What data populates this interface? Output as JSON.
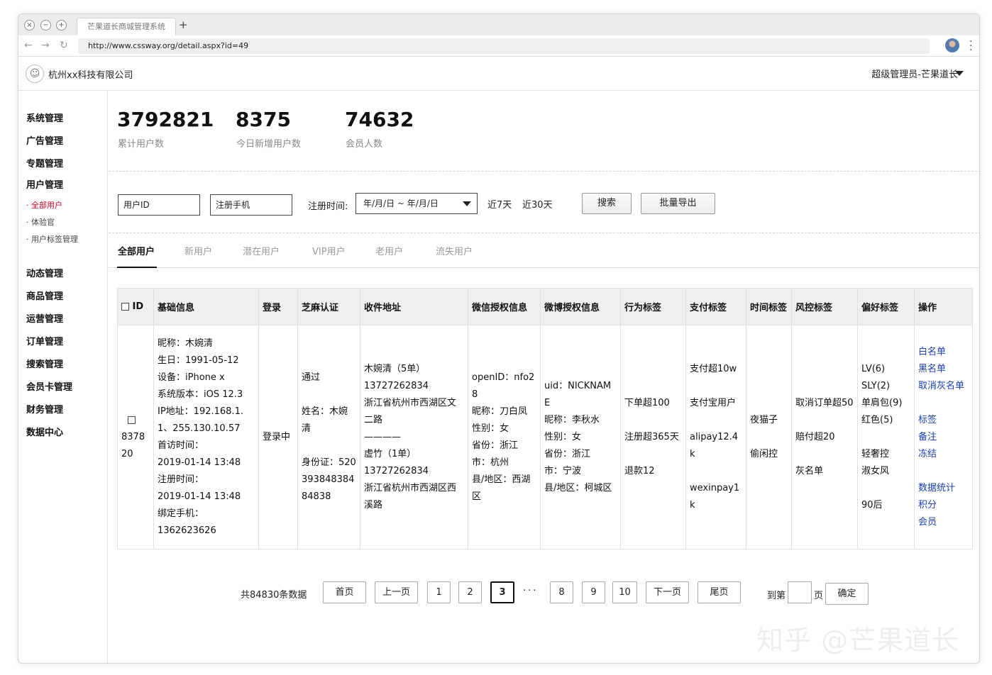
{
  "browser": {
    "tab_title": "芒果道长商城管理系统",
    "new_tab": "+",
    "url": "http://www.cssway.org/detail.aspx?id=49",
    "controls": {
      "close": "×",
      "minimize": "−",
      "maximize": "+"
    }
  },
  "header": {
    "company": "杭州xx科技有限公司",
    "user": "超级管理员-芒果道长"
  },
  "sidebar": {
    "groups_top": [
      "系统管理",
      "广告管理",
      "专题管理",
      "用户管理"
    ],
    "sub_items": [
      "· 全部用户",
      "· 体验官",
      "· 用户标签管理"
    ],
    "groups_bottom": [
      "动态管理",
      "商品管理",
      "运营管理",
      "订单管理",
      "搜索管理",
      "会员卡管理",
      "财务管理",
      "数据中心"
    ]
  },
  "stats": [
    {
      "value": "3792821",
      "label": "累计用户数"
    },
    {
      "value": "8375",
      "label": "今日新增用户数"
    },
    {
      "value": "74632",
      "label": "会员人数"
    }
  ],
  "filters": {
    "user_id": "用户ID",
    "phone": "注册手机",
    "reg_time_label": "注册时间:",
    "date_range": "年/月/日 ~ 年/月/日",
    "last7": "近7天",
    "last30": "近30天",
    "search": "搜索",
    "export": "批量导出"
  },
  "tabs": [
    "全部用户",
    "新用户",
    "潜在用户",
    "VIP用户",
    "老用户",
    "流失用户"
  ],
  "table": {
    "headers": [
      "ID",
      "基础信息",
      "登录",
      "芝麻认证",
      "收件地址",
      "微信授权信息",
      "微博授权信息",
      "行为标签",
      "支付标签",
      "时间标签",
      "风控标签",
      "偏好标签",
      "操作"
    ],
    "row": {
      "id": "837820",
      "basic": [
        "昵称：木婉清",
        "生日：1991-05-12",
        "设备：iPhone x",
        "系统版本：iOS 12.3",
        "IP地址：192.168.1.1、255.130.10.57",
        "首访时间：",
        "2019-01-14 13:48",
        "注册时间：",
        "2019-01-14 13:48",
        "绑定手机：",
        "1362623626"
      ],
      "login": "登录中",
      "zhima": [
        "通过",
        "",
        "姓名：木婉清",
        "",
        "身份证：52039384838484838"
      ],
      "address": [
        "木婉清（5单）",
        "13727262834",
        "浙江省杭州市西湖区文二路",
        "————",
        "虚竹（1单）",
        "13727262834",
        "浙江省杭州市西湖区西溪路"
      ],
      "wechat": [
        "openID：nfo28",
        "昵称：刀白凤",
        "性别：女",
        "省份：浙江",
        "市：杭州",
        "县/地区：西湖区"
      ],
      "weibo": [
        "uid：NICKNAME",
        "昵称：李秋水",
        "性别：女",
        "省份：浙江",
        "市：宁波",
        "县/地区：柯城区"
      ],
      "behavior": [
        "下单超100",
        "",
        "注册超365天",
        "",
        "退款12"
      ],
      "payment": [
        "支付超10w",
        "",
        "支付宝用户",
        "",
        "alipay12.4k",
        "",
        "wexinpay1k"
      ],
      "time": [
        "夜猫子",
        "",
        "偷闲控"
      ],
      "risk": [
        "取消订单超50",
        "",
        "赔付超20",
        "",
        "灰名单"
      ],
      "preference": [
        "LV(6)",
        "SLY(2)",
        "单肩包(9)",
        "红色(5)",
        "",
        "轻奢控",
        "淑女风",
        "",
        "90后"
      ],
      "actions": [
        "白名单",
        "黑名单",
        "取消灰名单",
        "",
        "标签",
        "备注",
        "冻结",
        "",
        "数据统计",
        "积分",
        "会员"
      ]
    }
  },
  "pagination": {
    "total": "共84830条数据",
    "first": "首页",
    "prev": "上一页",
    "pages": [
      "1",
      "2",
      "3"
    ],
    "current": "3",
    "ellipsis": "···",
    "pages_tail": [
      "8",
      "9",
      "10"
    ],
    "next": "下一页",
    "last": "尾页",
    "goto_label": "到第",
    "page_unit": "页",
    "confirm": "确定"
  },
  "watermark": "知乎 @芒果道长",
  "colors": {
    "active_sub": "#d0021b",
    "link": "#1a3fb8",
    "header_bg": "#efefef"
  }
}
